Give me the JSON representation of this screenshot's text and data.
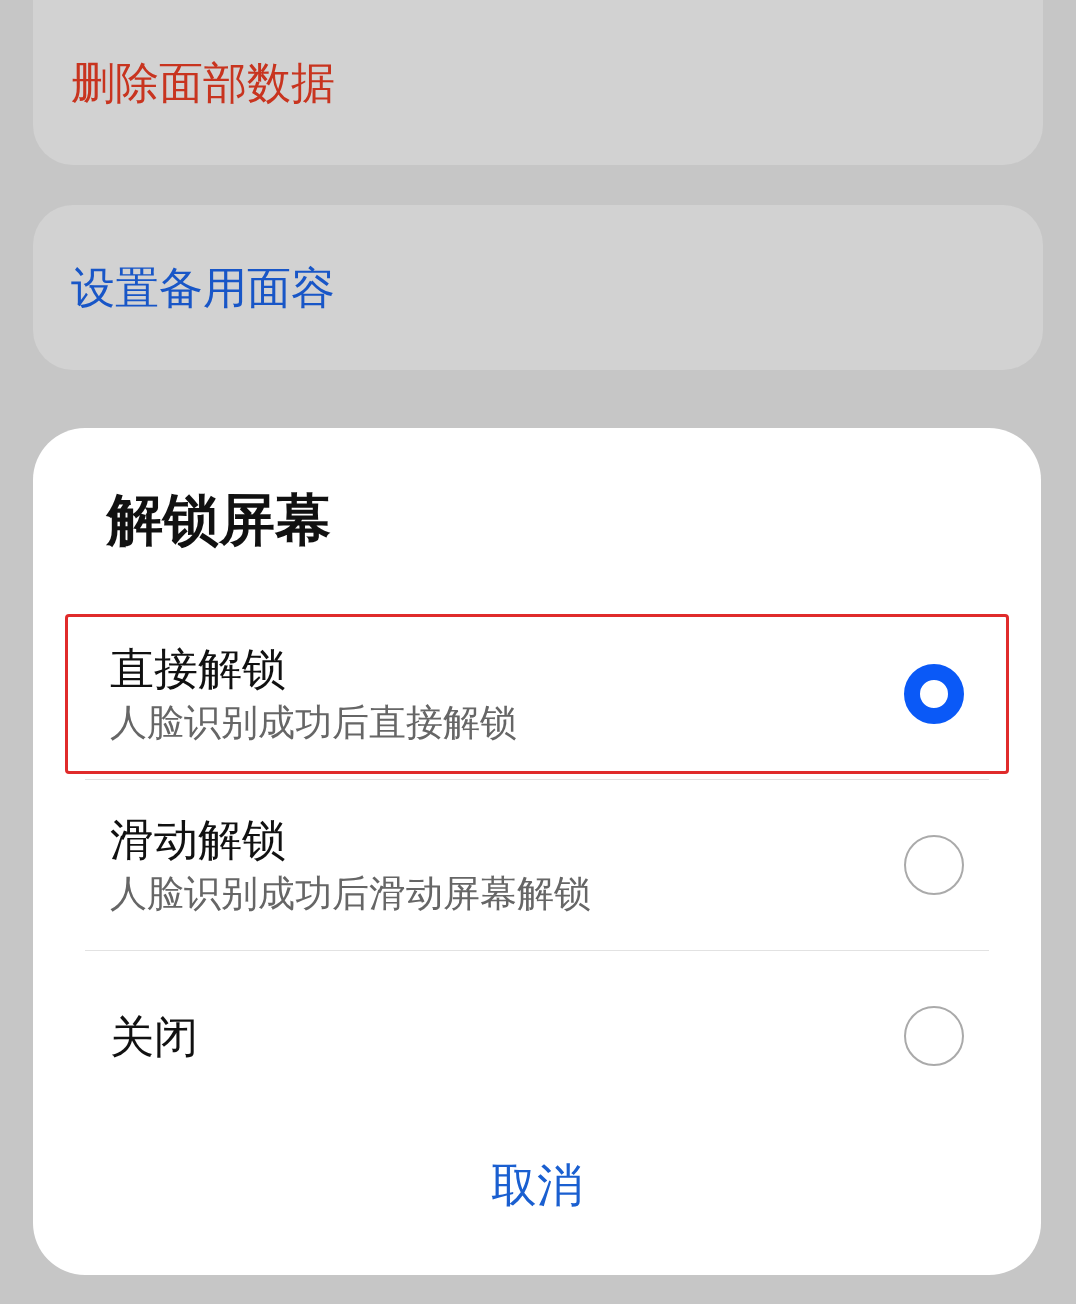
{
  "background": {
    "items": [
      {
        "label": "删除面部数据",
        "kind": "danger"
      },
      {
        "label": "设置备用面容",
        "kind": "link"
      }
    ]
  },
  "dialog": {
    "title": "解锁屏幕",
    "options": [
      {
        "title": "直接解锁",
        "subtitle": "人脸识别成功后直接解锁",
        "selected": true,
        "highlighted": true
      },
      {
        "title": "滑动解锁",
        "subtitle": "人脸识别成功后滑动屏幕解锁",
        "selected": false,
        "highlighted": false
      },
      {
        "title": "关闭",
        "selected": false,
        "highlighted": false
      }
    ],
    "cancel": "取消"
  }
}
